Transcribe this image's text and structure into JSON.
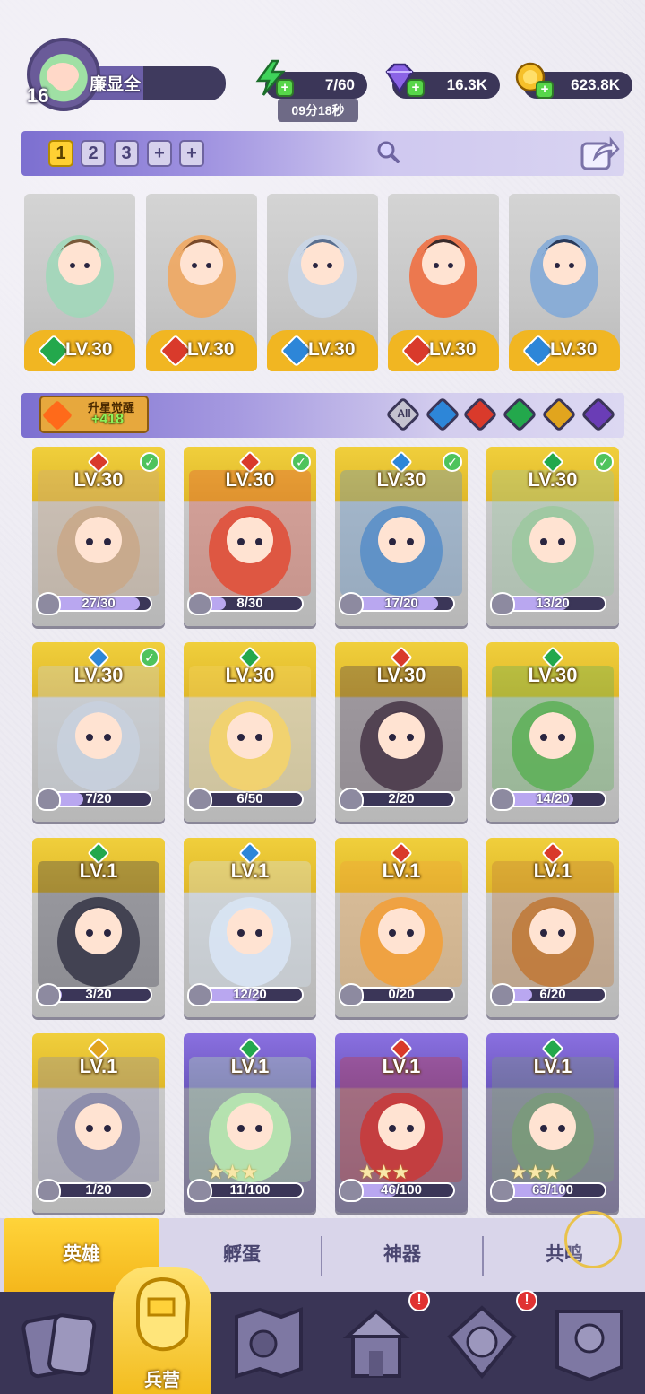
{
  "player": {
    "level": "16",
    "name": "廉显全"
  },
  "resources": {
    "energy": "7/60",
    "energy_timer": "09分18秒",
    "gems": "16.3K",
    "gold": "623.8K"
  },
  "team": {
    "tabs": [
      "1",
      "2",
      "3",
      "+",
      "+"
    ],
    "active_tab": "1",
    "heroes": [
      {
        "element": "green",
        "level": "LV.30"
      },
      {
        "element": "red",
        "level": "LV.30"
      },
      {
        "element": "blue",
        "level": "LV.30"
      },
      {
        "element": "red",
        "level": "LV.30"
      },
      {
        "element": "blue",
        "level": "LV.30"
      }
    ]
  },
  "filter": {
    "awaken_title": "升星觉醒",
    "awaken_count": "+418",
    "all_label": "All",
    "elements": [
      "blue",
      "red",
      "green",
      "gold",
      "purple"
    ]
  },
  "heroes": [
    {
      "level": "LV.30",
      "element": "red",
      "shards": "27/30",
      "progress": 0.9,
      "owned_check": true,
      "card": "gold"
    },
    {
      "level": "LV.30",
      "element": "red",
      "shards": "8/30",
      "progress": 0.27,
      "owned_check": true,
      "card": "gold"
    },
    {
      "level": "LV.30",
      "element": "blue",
      "shards": "17/20",
      "progress": 0.85,
      "owned_check": true,
      "card": "gold"
    },
    {
      "level": "LV.30",
      "element": "green",
      "shards": "13/20",
      "progress": 0.65,
      "owned_check": true,
      "card": "gold"
    },
    {
      "level": "LV.30",
      "element": "blue",
      "shards": "7/20",
      "progress": 0.35,
      "owned_check": true,
      "card": "gold"
    },
    {
      "level": "LV.30",
      "element": "green",
      "shards": "6/50",
      "progress": 0.12,
      "owned_check": false,
      "card": "gold"
    },
    {
      "level": "LV.30",
      "element": "red",
      "shards": "2/20",
      "progress": 0.1,
      "owned_check": false,
      "card": "gold"
    },
    {
      "level": "LV.30",
      "element": "green",
      "shards": "14/20",
      "progress": 0.7,
      "owned_check": false,
      "card": "gold"
    },
    {
      "level": "LV.1",
      "element": "green",
      "shards": "3/20",
      "progress": 0.15,
      "owned_check": false,
      "card": "gold"
    },
    {
      "level": "LV.1",
      "element": "blue",
      "shards": "12/20",
      "progress": 0.6,
      "owned_check": false,
      "card": "gold"
    },
    {
      "level": "LV.1",
      "element": "red",
      "shards": "0/20",
      "progress": 0.0,
      "owned_check": false,
      "card": "gold"
    },
    {
      "level": "LV.1",
      "element": "red",
      "shards": "6/20",
      "progress": 0.3,
      "owned_check": false,
      "card": "gold"
    },
    {
      "level": "LV.1",
      "element": "gold",
      "shards": "1/20",
      "progress": 0.05,
      "owned_check": false,
      "card": "gold"
    },
    {
      "level": "LV.1",
      "element": "green",
      "shards": "11/100",
      "progress": 0.11,
      "owned_check": false,
      "card": "purple",
      "stars": "★★★"
    },
    {
      "level": "LV.1",
      "element": "red",
      "shards": "46/100",
      "progress": 0.46,
      "owned_check": false,
      "card": "purple",
      "stars": "★★★"
    },
    {
      "level": "LV.1",
      "element": "green",
      "shards": "63/100",
      "progress": 0.63,
      "owned_check": false,
      "card": "purple",
      "stars": "★★★"
    }
  ],
  "tabs": {
    "heroes": "英雄",
    "hatch": "孵蛋",
    "artifact": "神器",
    "resonance": "共鸣"
  },
  "nav": {
    "barracks": "兵营",
    "badge": "!"
  },
  "colors": {
    "green": "#23a84c",
    "red": "#d93a2b",
    "blue": "#2d86d8",
    "gold": "#e1a51e",
    "purple": "#6a3db6"
  }
}
